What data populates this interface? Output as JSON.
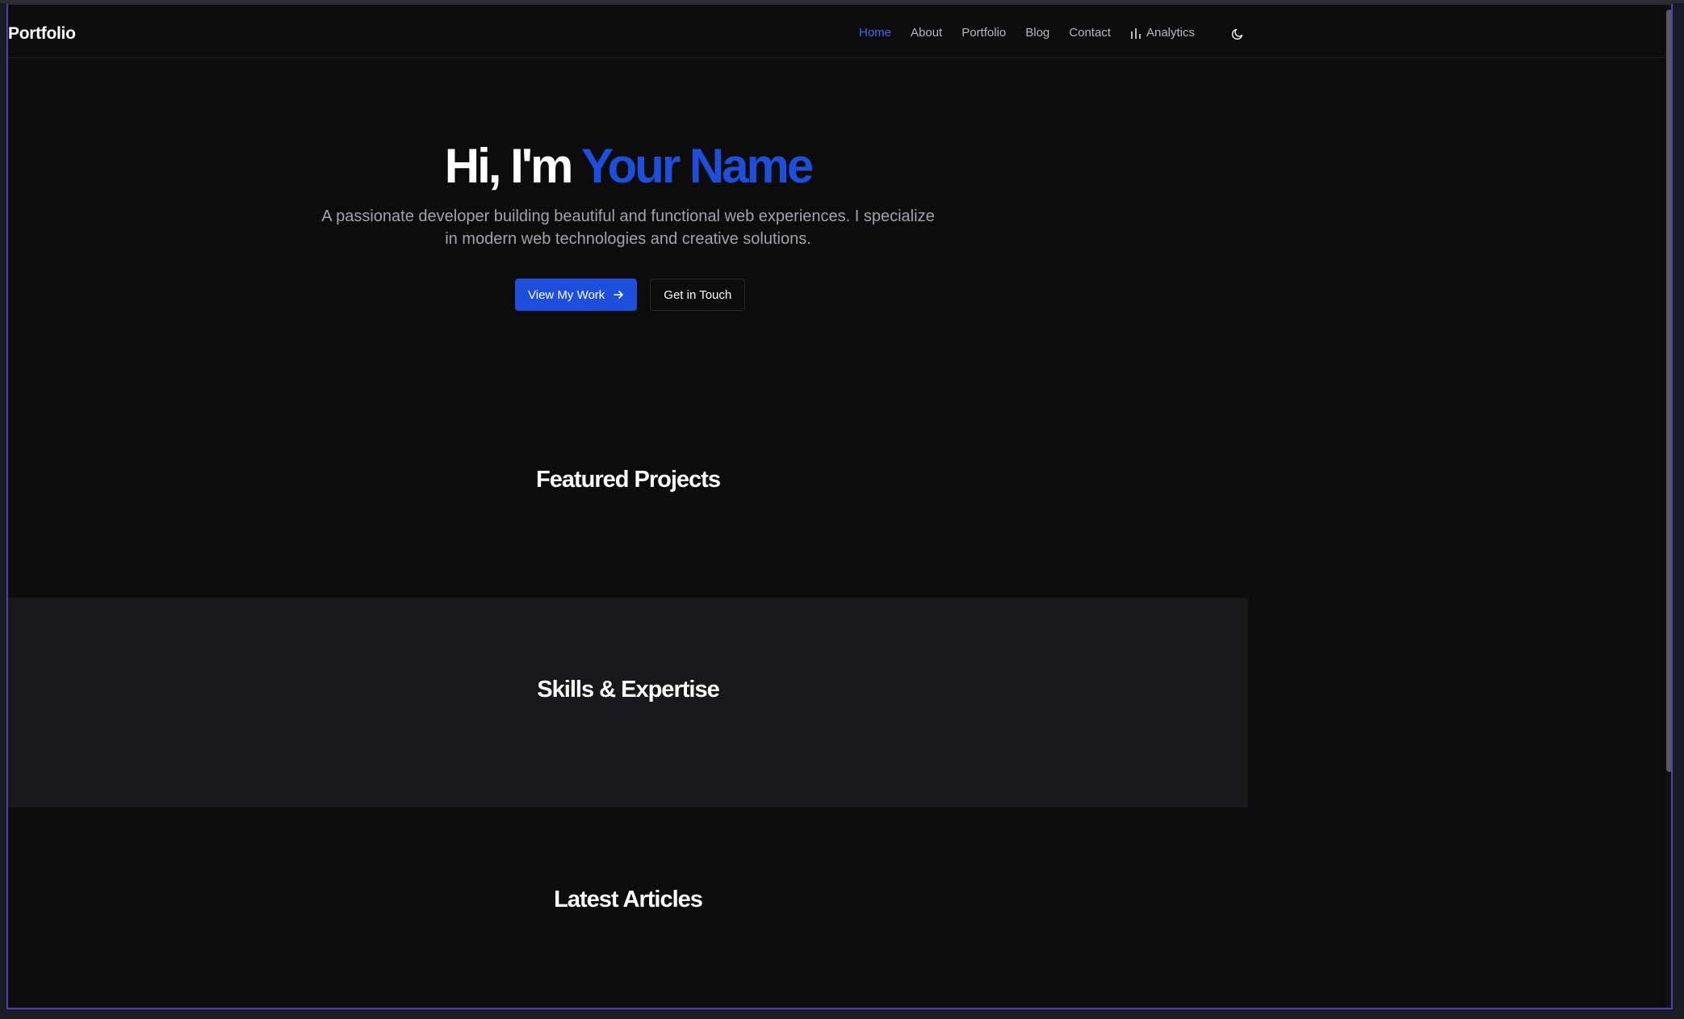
{
  "navbar": {
    "brand": "Portfolio",
    "links": [
      {
        "label": "Home",
        "active": true
      },
      {
        "label": "About"
      },
      {
        "label": "Portfolio"
      },
      {
        "label": "Blog"
      },
      {
        "label": "Contact"
      },
      {
        "label": "Analytics",
        "icon": "bar-chart-icon"
      }
    ],
    "theme_toggle_icon": "moon-icon"
  },
  "hero": {
    "title_prefix": "Hi, I'm ",
    "title_name": "Your Name",
    "subtitle": "A passionate developer building beautiful and functional web experiences. I specialize in modern web technologies and creative solutions.",
    "primary_button": "View My Work",
    "primary_button_icon": "arrow-right-icon",
    "secondary_button": "Get in Touch"
  },
  "sections": {
    "featured": "Featured Projects",
    "skills": "Skills & Expertise",
    "articles": "Latest Articles"
  },
  "colors": {
    "accent": "#1d4fdc",
    "background": "#0c0c0d",
    "band": "#18181b"
  }
}
